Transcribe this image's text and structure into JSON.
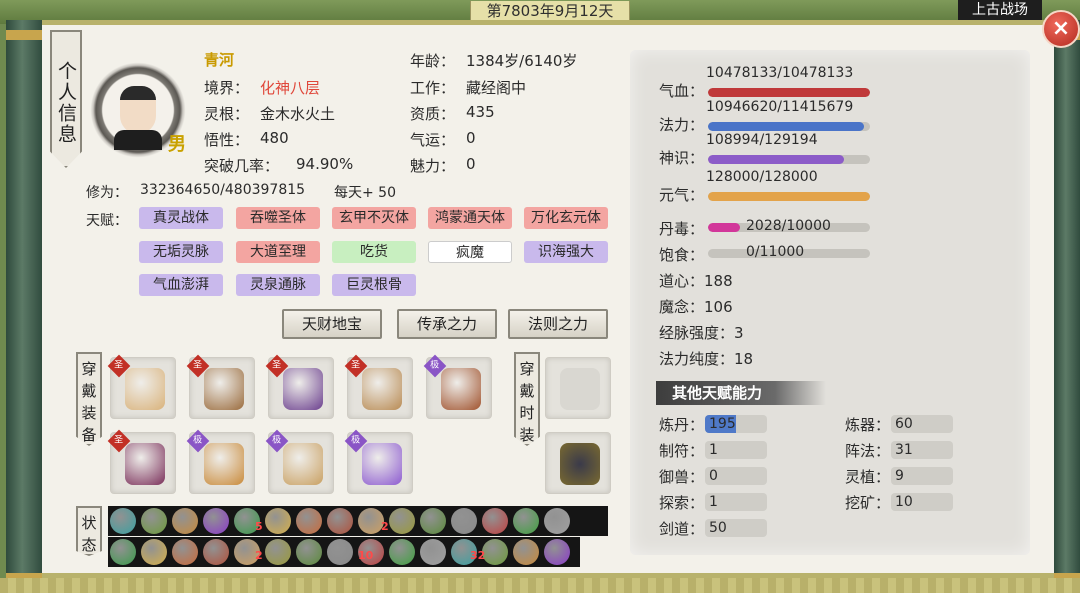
{
  "top": {
    "date": "第7803年9月12天",
    "battle_label": "上古战场",
    "close_glyph": "×"
  },
  "tab_label": "个人信息",
  "character": {
    "name": "青河",
    "gender": "男",
    "realm_label": "境界：",
    "realm": "化神八层",
    "root_label": "灵根：",
    "root": "金木水火土",
    "wisdom_label": "悟性：",
    "wisdom": "480",
    "breakthrough_label": "突破几率：",
    "breakthrough": "94.90%",
    "age_label": "年龄：",
    "age": "1384岁/6140岁",
    "job_label": "工作：",
    "job": "藏经阁中",
    "aptitude_label": "资质：",
    "aptitude": "435",
    "luck_label": "气运：",
    "luck": "0",
    "charm_label": "魅力：",
    "charm": "0",
    "cultivation_label": "修为：",
    "cultivation": "332364650/480397815",
    "daily_label": "每天+ 50"
  },
  "talents_label": "天赋：",
  "talents": [
    {
      "label": "真灵战体",
      "color": "purple"
    },
    {
      "label": "吞噬圣体",
      "color": "red"
    },
    {
      "label": "玄甲不灭体",
      "color": "red"
    },
    {
      "label": "鸿蒙通天体",
      "color": "red"
    },
    {
      "label": "万化玄元体",
      "color": "red"
    },
    {
      "label": "无垢灵脉",
      "color": "purple"
    },
    {
      "label": "大道至理",
      "color": "red"
    },
    {
      "label": "吃货",
      "color": "green"
    },
    {
      "label": "疯魔",
      "color": "white"
    },
    {
      "label": "识海强大",
      "color": "purple"
    },
    {
      "label": "气血澎湃",
      "color": "purple"
    },
    {
      "label": "灵泉通脉",
      "color": "purple"
    },
    {
      "label": "巨灵根骨",
      "color": "purple"
    }
  ],
  "buttons": [
    "天财地宝",
    "传承之力",
    "法则之力"
  ],
  "equip_label": "穿戴装备",
  "fashion_label": "穿戴时装",
  "status_label": "状态",
  "equipment": [
    {
      "name": "robe-icon",
      "tag": "圣",
      "tag_color": "red",
      "color": "#d9b27a"
    },
    {
      "name": "sword-icon",
      "tag": "圣",
      "tag_color": "red",
      "color": "#9a6b3c"
    },
    {
      "name": "amulet-icon",
      "tag": "圣",
      "tag_color": "red",
      "color": "#6b3f8e"
    },
    {
      "name": "boots-icon",
      "tag": "圣",
      "tag_color": "red",
      "color": "#b88a52"
    },
    {
      "name": "pickaxe-icon",
      "tag": "极",
      "tag_color": "purple",
      "color": "#a0522d"
    },
    {
      "name": "cape-icon",
      "tag": "圣",
      "tag_color": "red",
      "color": "#7a2f5a"
    },
    {
      "name": "orb-icon",
      "tag": "极",
      "tag_color": "purple",
      "color": "#c98a3a"
    },
    {
      "name": "shell-icon",
      "tag": "极",
      "tag_color": "purple",
      "color": "#c9a062"
    },
    {
      "name": "dagger-icon",
      "tag": "极",
      "tag_color": "purple",
      "color": "#8c5ad0"
    }
  ],
  "status_icon_counts": {
    "row1": 15,
    "row2": 15
  },
  "status_numbers": [
    "2",
    "5",
    "10",
    "2",
    "32"
  ],
  "stats": [
    {
      "label": "气血：",
      "value": "10478133/10478133",
      "fraction": 1.0,
      "color": "#c0393a"
    },
    {
      "label": "法力：",
      "value": "10946620/11415679",
      "fraction": 0.96,
      "color": "#4a74c8"
    },
    {
      "label": "神识：",
      "value": "108994/129194",
      "fraction": 0.84,
      "color": "#8c5cc8"
    },
    {
      "label": "元气：",
      "value": "128000/128000",
      "fraction": 1.0,
      "color": "#e3a34a"
    },
    {
      "label": "丹毒：",
      "value": "2028/10000",
      "fraction": 0.2,
      "color": "#d2379a"
    },
    {
      "label": "饱食：",
      "value": "0/11000",
      "fraction": 0.0,
      "color": "#8aa050"
    }
  ],
  "plain_stats": [
    {
      "label": "道心：",
      "value": "188"
    },
    {
      "label": "魔念：",
      "value": "106"
    },
    {
      "label": "经脉强度：",
      "value": "3"
    },
    {
      "label": "法力纯度：",
      "value": "18"
    }
  ],
  "other_talent_title": "其他天赋能力",
  "skills": [
    {
      "label": "炼丹：",
      "value": "195",
      "fraction": 0.5
    },
    {
      "label": "制符：",
      "value": "1",
      "fraction": 0
    },
    {
      "label": "御兽：",
      "value": "0",
      "fraction": 0
    },
    {
      "label": "探索：",
      "value": "1",
      "fraction": 0
    },
    {
      "label": "剑道：",
      "value": "50",
      "fraction": 0
    },
    {
      "label": "炼器：",
      "value": "60",
      "fraction": 0
    },
    {
      "label": "阵法：",
      "value": "31",
      "fraction": 0
    },
    {
      "label": "灵植：",
      "value": "9",
      "fraction": 0
    },
    {
      "label": "挖矿：",
      "value": "10",
      "fraction": 0
    }
  ]
}
